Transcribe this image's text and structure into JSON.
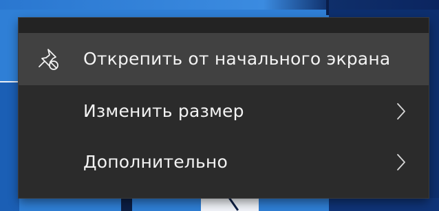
{
  "context_menu": {
    "items": [
      {
        "label": "Открепить от начального экрана",
        "icon": "unpin-icon",
        "has_submenu": false,
        "highlighted": true
      },
      {
        "label": "Изменить размер",
        "icon": null,
        "has_submenu": true,
        "highlighted": false
      },
      {
        "label": "Дополнительно",
        "icon": null,
        "has_submenu": true,
        "highlighted": false
      }
    ]
  },
  "colors": {
    "menu_background": "#2b2b2b",
    "menu_highlight": "#414141",
    "menu_text": "#f3f3f3",
    "desktop_blue": "#2f7fd6",
    "desktop_dark": "#0d2f6e"
  }
}
